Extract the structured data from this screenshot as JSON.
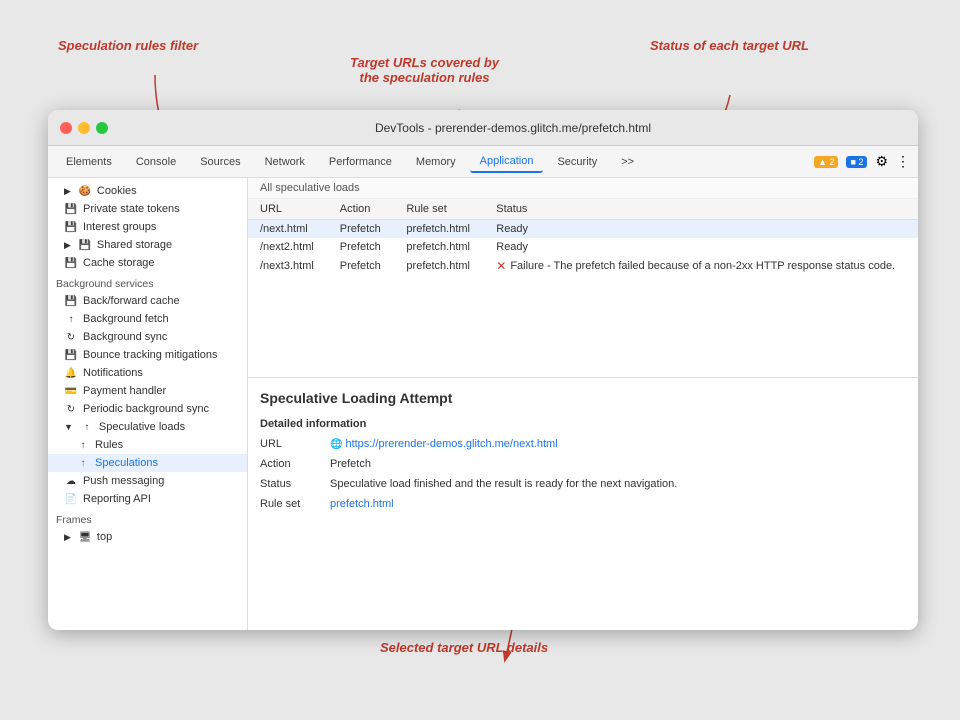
{
  "annotations": {
    "speculation_rules_filter": "Speculation rules filter",
    "target_urls_covered": "Target URLs covered by\nthe speculation rules",
    "status_each_url": "Status of each target URL",
    "selected_target_details": "Selected target URL details"
  },
  "window": {
    "title": "DevTools - prerender-demos.glitch.me/prefetch.html",
    "traffic_lights": [
      "red",
      "yellow",
      "green"
    ]
  },
  "toolbar": {
    "tabs": [
      {
        "label": "Elements",
        "active": false
      },
      {
        "label": "Console",
        "active": false
      },
      {
        "label": "Sources",
        "active": false
      },
      {
        "label": "Network",
        "active": false
      },
      {
        "label": "Performance",
        "active": false
      },
      {
        "label": "Memory",
        "active": false
      },
      {
        "label": "Application",
        "active": true
      },
      {
        "label": "Security",
        "active": false
      },
      {
        "label": ">>",
        "active": false
      }
    ],
    "badges": [
      {
        "type": "warning",
        "count": "▲ 2"
      },
      {
        "type": "info",
        "count": "■ 2"
      }
    ],
    "gear_icon": "⚙",
    "more_icon": "⋮"
  },
  "sidebar": {
    "cookies_section": {
      "items": [
        {
          "label": "Cookies",
          "icon": "🍪",
          "indent": 0,
          "has_arrow": true
        },
        {
          "label": "Private state tokens",
          "icon": "💾",
          "indent": 0
        },
        {
          "label": "Interest groups",
          "icon": "💾",
          "indent": 0
        },
        {
          "label": "Shared storage",
          "icon": "💾",
          "indent": 0,
          "has_arrow": true
        },
        {
          "label": "Cache storage",
          "icon": "💾",
          "indent": 0
        }
      ]
    },
    "background_services": {
      "label": "Background services",
      "items": [
        {
          "label": "Back/forward cache",
          "icon": "💾",
          "indent": 0
        },
        {
          "label": "Background fetch",
          "icon": "↑",
          "indent": 0
        },
        {
          "label": "Background sync",
          "icon": "↻",
          "indent": 0
        },
        {
          "label": "Bounce tracking mitigations",
          "icon": "💾",
          "indent": 0
        },
        {
          "label": "Notifications",
          "icon": "🔔",
          "indent": 0
        },
        {
          "label": "Payment handler",
          "icon": "💳",
          "indent": 0
        },
        {
          "label": "Periodic background sync",
          "icon": "↻",
          "indent": 0
        },
        {
          "label": "Speculative loads",
          "icon": "↑",
          "indent": 0,
          "has_arrow": true,
          "expanded": true
        },
        {
          "label": "Rules",
          "icon": "↑",
          "indent": 1
        },
        {
          "label": "Speculations",
          "icon": "↑",
          "indent": 1,
          "selected": true
        },
        {
          "label": "Push messaging",
          "icon": "☁",
          "indent": 0
        },
        {
          "label": "Reporting API",
          "icon": "📄",
          "indent": 0
        }
      ]
    },
    "frames": {
      "label": "Frames",
      "items": [
        {
          "label": "top",
          "icon": "🖥",
          "indent": 0,
          "has_arrow": true
        }
      ]
    }
  },
  "speculative_loads_section": {
    "header": "All speculative loads",
    "columns": [
      "URL",
      "Action",
      "Rule set",
      "Status"
    ],
    "rows": [
      {
        "url": "/next.html",
        "action": "Prefetch",
        "rule_set": "prefetch.html",
        "status": "Ready",
        "status_type": "ready",
        "selected": true
      },
      {
        "url": "/next2.html",
        "action": "Prefetch",
        "rule_set": "prefetch.html",
        "status": "Ready",
        "status_type": "ready"
      },
      {
        "url": "/next3.html",
        "action": "Prefetch",
        "rule_set": "prefetch.html",
        "status": "Failure - The prefetch failed because of a non-2xx HTTP response status code.",
        "status_type": "error"
      }
    ]
  },
  "detail_panel": {
    "title": "Speculative Loading Attempt",
    "section_title": "Detailed information",
    "rows": [
      {
        "label": "URL",
        "value": "https://prerender-demos.glitch.me/next.html",
        "type": "link"
      },
      {
        "label": "Action",
        "value": "Prefetch",
        "type": "text"
      },
      {
        "label": "Status",
        "value": "Speculative load finished and the result is ready for the next navigation.",
        "type": "text"
      },
      {
        "label": "Rule set",
        "value": "prefetch.html",
        "type": "link"
      }
    ]
  }
}
